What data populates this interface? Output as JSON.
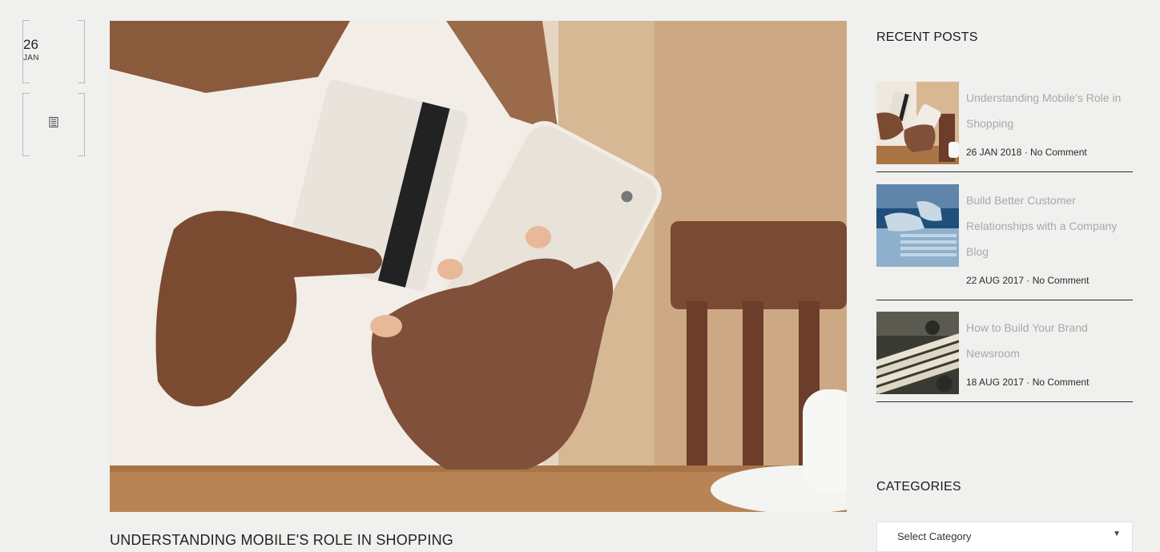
{
  "post": {
    "day": "26",
    "month": "JAN",
    "format_icon": "document-icon",
    "title": "UNDERSTANDING MOBILE'S ROLE IN SHOPPING"
  },
  "sidebar": {
    "recent_posts_title": "RECENT POSTS",
    "recent_posts": [
      {
        "title": "Understanding Mobile's Role in Shopping",
        "meta": "26 JAN 2018 · No Comment"
      },
      {
        "title": "Build Better Customer Relationships with a Company Blog",
        "meta": "22 AUG 2017 · No Comment"
      },
      {
        "title": "How to Build Your Brand Newsroom",
        "meta": "18 AUG 2017 · No Comment"
      }
    ],
    "categories_title": "CATEGORIES",
    "category_select": {
      "value": "Select Category"
    }
  }
}
